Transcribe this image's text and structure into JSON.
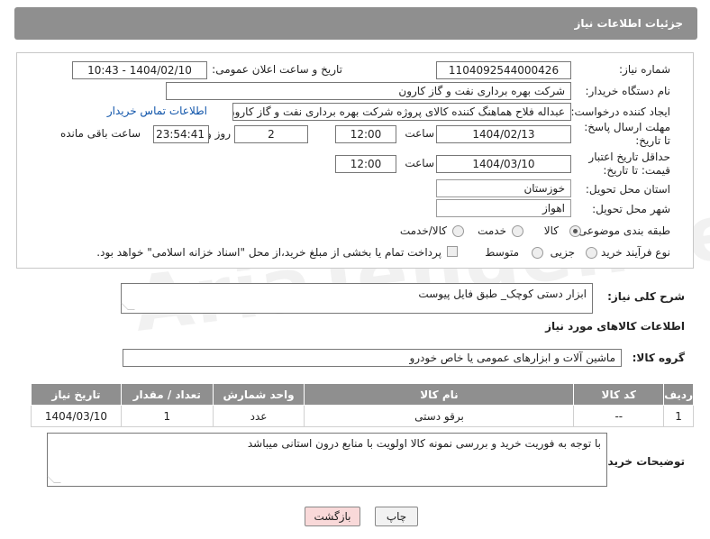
{
  "header": {
    "title": "جزئیات اطلاعات نیاز"
  },
  "form": {
    "need_number_label": "شماره نیاز:",
    "need_number": "1104092544000426",
    "announce_label": "تاریخ و ساعت اعلان عمومی:",
    "announce_value": "1404/02/10 - 10:43",
    "buyer_org_label": "نام دستگاه خریدار:",
    "buyer_org": "شرکت بهره برداری نفت و گاز کارون",
    "creator_label": "ایجاد کننده درخواست:",
    "creator": "عبداله فلاح هماهنگ کننده کالای پروژه شرکت بهره برداری نفت و گاز کارون",
    "contact_link": "اطلاعات تماس خریدار",
    "deadline_label": "مهلت ارسال پاسخ: تا تاریخ:",
    "deadline_date": "1404/02/13",
    "time_label": "ساعت",
    "deadline_time": "12:00",
    "days_value": "2",
    "days_label": "روز و",
    "remaining_value": "23:54:41",
    "remaining_label": "ساعت باقی مانده",
    "validity_label": "حداقل تاریخ اعتبار قیمت: تا تاریخ:",
    "validity_date": "1404/03/10",
    "validity_time": "12:00",
    "province_label": "استان محل تحویل:",
    "province": "خوزستان",
    "city_label": "شهر محل تحویل:",
    "city": "اهواز",
    "category_label": "طبقه بندی موضوعی:",
    "category_options": [
      "کالا",
      "خدمت",
      "کالا/خدمت"
    ],
    "process_label": "نوع فرآیند خرید :",
    "process_options": [
      "جزیی",
      "متوسط"
    ],
    "payment_note": "پرداخت تمام یا بخشی از مبلغ خرید،از محل \"اسناد خزانه اسلامی\" خواهد بود."
  },
  "description": {
    "label": "شرح کلی نیاز:",
    "value": "ابزار دستی کوچک_ طبق فایل پیوست"
  },
  "goods_section": {
    "title": "اطلاعات کالاهای مورد نیاز",
    "group_label": "گروه کالا:",
    "group_value": "ماشین آلات و ابزارهای عمومی یا خاص خودرو"
  },
  "table": {
    "headers": [
      "ردیف",
      "کد کالا",
      "نام کالا",
      "واحد شمارش",
      "تعداد / مقدار",
      "تاریخ نیاز"
    ],
    "rows": [
      [
        "1",
        "--",
        "برقو دستی",
        "عدد",
        "1",
        "1404/03/10"
      ]
    ]
  },
  "buyer_notes": {
    "label": "توضیحات خریدار:",
    "value": "با توجه به فوریت خرید و بررسی نمونه کالا اولویت با منابع درون استانی میباشد"
  },
  "buttons": {
    "print": "چاپ",
    "back": "بازگشت"
  },
  "watermark": {
    "text": "AriaTender.net"
  }
}
